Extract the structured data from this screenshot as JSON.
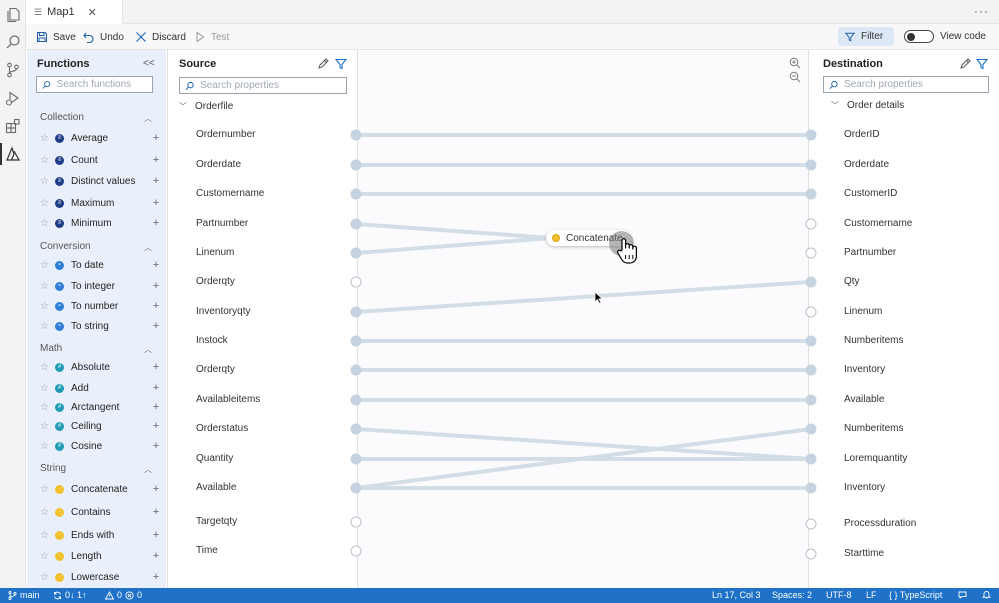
{
  "tab": {
    "title": "Map1",
    "close": "✕",
    "more": "···"
  },
  "toolbar": {
    "save": "Save",
    "undo": "Undo",
    "discard": "Discard",
    "test": "Test",
    "filter": "Filter",
    "view_code": "View code"
  },
  "functions": {
    "title": "Functions",
    "search_placeholder": "Search functions",
    "categories": [
      {
        "name": "Collection",
        "color": "#1f3c88",
        "items": [
          "Average",
          "Count",
          "Distinct values",
          "Maximum",
          "Minimum"
        ]
      },
      {
        "name": "Conversion",
        "color": "#2f7ed8",
        "items": [
          "To date",
          "To integer",
          "To number",
          "To string"
        ]
      },
      {
        "name": "Math",
        "color": "#1f9bb3",
        "items": [
          "Absolute",
          "Add",
          "Arctangent",
          "Ceiling",
          "Cosine"
        ]
      },
      {
        "name": "String",
        "color": "#f2c12e",
        "items": [
          "Concatenate",
          "Contains",
          "Ends with",
          "Length",
          "Lowercase"
        ]
      }
    ]
  },
  "source": {
    "title": "Source",
    "search_placeholder": "Search properties",
    "root": "Orderfile",
    "fields": [
      "Ordernumber",
      "Orderdate",
      "Customername",
      "Partnumber",
      "Linenum",
      "Orderqty",
      "Inventoryqty",
      "Instock",
      "Orderqty",
      "Availableitems",
      "Orderstatus",
      "Quantity",
      "Available",
      "Targetqty",
      "Time"
    ]
  },
  "destination": {
    "title": "Destination",
    "search_placeholder": "Search properties",
    "root": "Order details",
    "fields": [
      "OrderID",
      "Orderdate",
      "CustomerID",
      "Customername",
      "Partnumber",
      "Qty",
      "Linenum",
      "Numberitems",
      "Inventory",
      "Available",
      "Numberitems",
      "Loremquantity",
      "Inventory",
      "Processduration",
      "Starttime"
    ]
  },
  "canvas": {
    "function_node": "Concatenate",
    "connected_source": [
      0,
      1,
      2,
      3,
      4,
      6,
      7,
      8,
      9,
      10,
      11,
      12
    ],
    "connected_dest": [
      0,
      1,
      2,
      5,
      7,
      8,
      9,
      10,
      11,
      12
    ],
    "direct_links": [
      [
        0,
        0
      ],
      [
        1,
        1
      ],
      [
        2,
        2
      ],
      [
        6,
        5
      ],
      [
        7,
        7
      ],
      [
        8,
        8
      ],
      [
        9,
        9
      ],
      [
        10,
        11
      ],
      [
        11,
        11
      ],
      [
        12,
        10
      ],
      [
        12,
        12
      ]
    ],
    "to_function": [
      3,
      4
    ]
  },
  "status": {
    "branch": "main",
    "sync": "0↓ 1↑",
    "problems": "0",
    "errors": "0",
    "position": "Ln 17, Col 3",
    "spaces": "Spaces: 2",
    "encoding": "UTF-8",
    "eol": "LF",
    "language": "{ } TypeScript"
  },
  "colors": {
    "accent": "#1f72c8",
    "wire": "#d3dde6",
    "node": "#c5d3e0",
    "panel": "#e9f0fb"
  }
}
